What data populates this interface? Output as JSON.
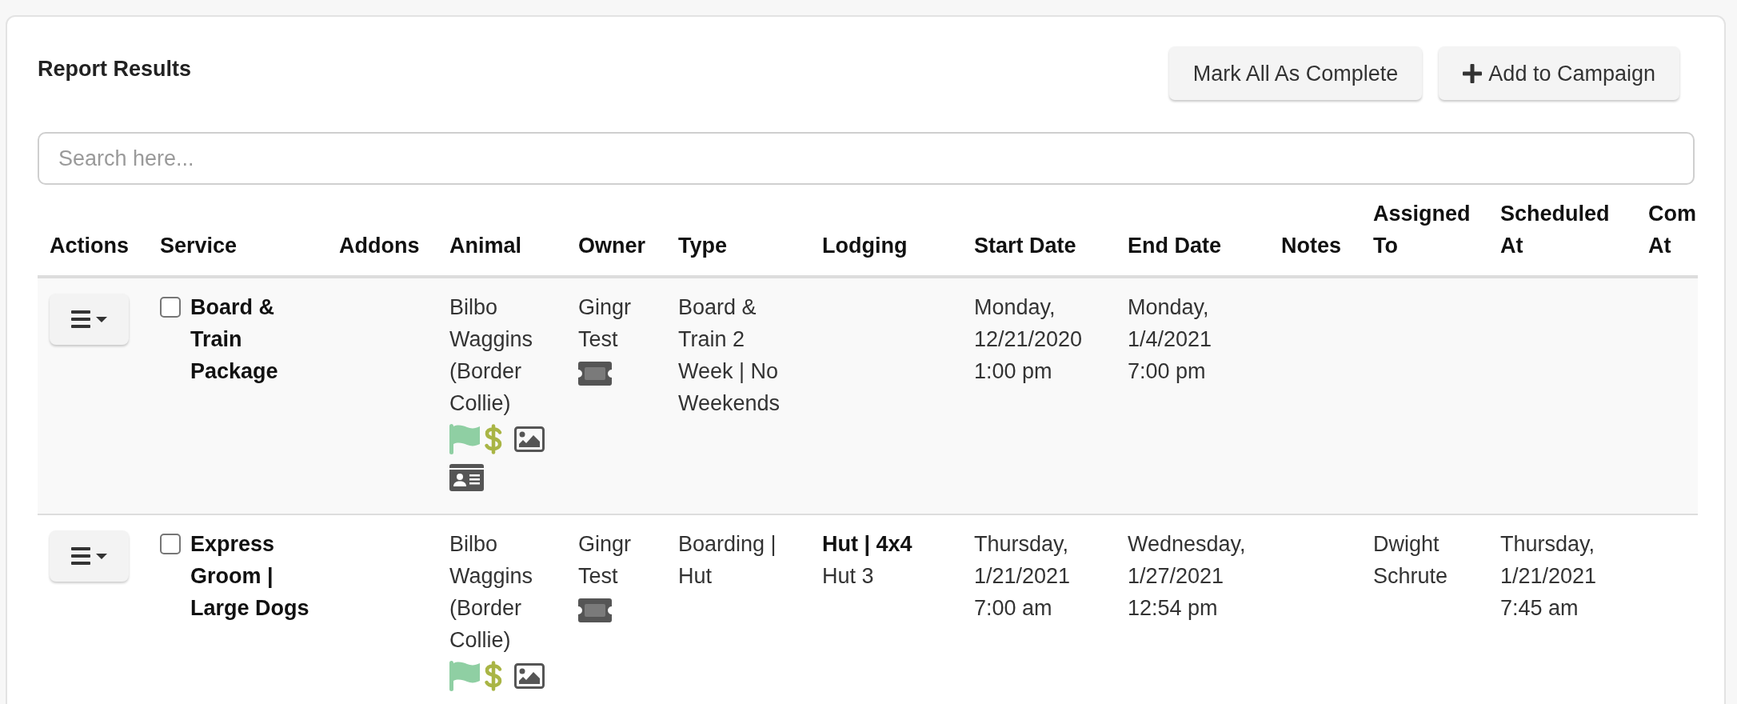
{
  "title": "Report Results",
  "buttons": [
    {
      "label": "Mark All As Complete",
      "kind": "plain"
    },
    {
      "label": "Add to Campaign",
      "kind": "add"
    }
  ],
  "search": {
    "placeholder": "Search here..."
  },
  "table": {
    "columns": [
      "Actions",
      "Service",
      "Addons",
      "Animal",
      "Owner",
      "Type",
      "Lodging",
      "Start Date",
      "End Date",
      "Notes",
      "Assigned To",
      "Scheduled At",
      "Com At"
    ],
    "rows": [
      {
        "service": {
          "name": "Board & Train Package",
          "checked": false
        },
        "animal": {
          "name": "Bilbo Waggins (Border Collie)",
          "icons": [
            {
              "kind": "flag",
              "color": "#8fcfa3"
            },
            {
              "kind": "dollar",
              "color": "#a9b545"
            },
            {
              "kind": "image",
              "color": "#555555"
            },
            {
              "kind": "id_card",
              "color": "#555555"
            }
          ]
        },
        "owner": {
          "name": "Gingr Test",
          "icons": [
            {
              "kind": "ticket"
            }
          ]
        },
        "type": "Board & Train 2 Week | No Weekends",
        "start_date": "Monday, 12/21/2020 1:00 pm",
        "end_date": "Monday, 1/4/2021 7:00 pm"
      },
      {
        "service": {
          "name": "Express Groom | Large Dogs",
          "checked": false
        },
        "animal": {
          "name": "Bilbo Waggins (Border Collie)",
          "icons": [
            {
              "kind": "flag",
              "color": "#8fcfa3"
            },
            {
              "kind": "dollar",
              "color": "#a9b545"
            },
            {
              "kind": "image",
              "color": "#555555"
            }
          ]
        },
        "owner": {
          "name": "Gingr Test",
          "icons": [
            {
              "kind": "ticket"
            }
          ]
        },
        "type": "Boarding | Hut",
        "lodging": {
          "name": "Hut | 4x4",
          "unit": "Hut 3"
        },
        "start_date": "Thursday, 1/21/2021 7:00 am",
        "end_date": "Wednesday, 1/27/2021 12:54 pm",
        "assigned_to": "Dwight Schrute",
        "scheduled_at": "Thursday, 1/21/2021 7:45 am"
      }
    ]
  }
}
